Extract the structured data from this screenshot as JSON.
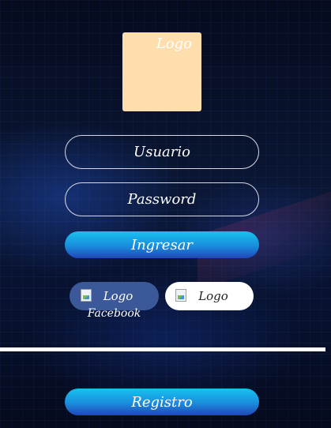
{
  "logo": {
    "alt_text": "Logo"
  },
  "form": {
    "user_placeholder": "Usuario",
    "password_placeholder": "Password",
    "login_label": "Ingresar"
  },
  "social": {
    "facebook": {
      "alt_text": "Logo",
      "caption": "Facebook"
    },
    "google": {
      "alt_text": "Logo"
    }
  },
  "register": {
    "label": "Registro"
  },
  "colors": {
    "logo_bg": "#ffdead",
    "button_gradient_top": "#17c2ef",
    "button_gradient_bottom": "#2146b8",
    "facebook_bg": "#3b5998",
    "google_bg": "#ffffff"
  }
}
